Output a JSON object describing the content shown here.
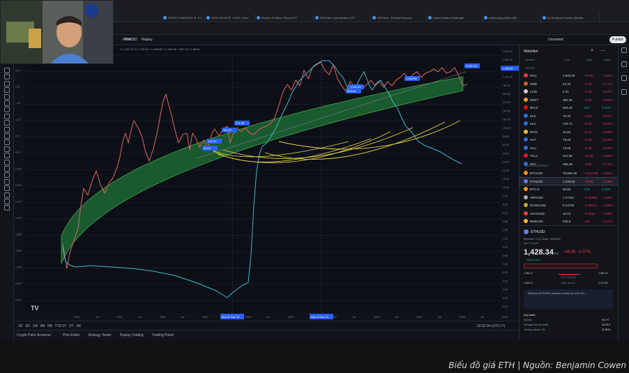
{
  "browser": {
    "tabs": [
      {
        "label": "ERFRT 0.00002208 ▼ -0.1"
      },
      {
        "label": "GGG 416.05 ▼ -1.06% | Unru"
      },
      {
        "label": "Modern Portfolio Theory | ET"
      },
      {
        "label": "ROI After Cycle Bottom | ET"
      },
      {
        "label": "EDPNow - Federal Reserve"
      },
      {
        "label": "United States Challenger"
      },
      {
        "label": "solidbull.jpg (640×480)"
      },
      {
        "label": "(1) Benjamin Cowen (@inthe"
      }
    ]
  },
  "toolbar": {
    "symbol": "ETHUSD",
    "alert": "Alert",
    "replay": "Replay",
    "layout": "Unnamed",
    "publish": "Publish",
    "ohlc": "O 1,427.37  H 1,790.43  L 1,408.96  C 1,428.83  −493.74 (−7.86%)"
  },
  "chart": {
    "price_labels": [
      {
        "text": "2,091.75",
        "color": "#2962ff"
      },
      {
        "text": "1,544.64",
        "color": "#2962ff"
      },
      {
        "text": "1,262.69",
        "color": "#2962ff"
      },
      {
        "text": "890.84",
        "color": "#2962ff"
      },
      {
        "text": "221.05",
        "color": "#2962ff"
      },
      {
        "text": "163.57",
        "color": "#2962ff"
      },
      {
        "text": "184.51",
        "color": "#2962ff"
      },
      {
        "text": "81.09",
        "color": "#2962ff"
      }
    ],
    "y_axis_right": [
      "3,000.00",
      "2,600.00",
      "1,428.83",
      "1,100.00",
      "780.00",
      "540.00",
      "376.00",
      "260.00",
      "180.00",
      "130.00",
      "90.00",
      "64.00",
      "44.00",
      "31.00",
      "22.00",
      "15.00",
      "11.00",
      "7.60",
      "5.30",
      "3.70",
      "2.60",
      "1.80",
      "1.25",
      "0.87",
      "0.60",
      "0.42",
      "0.29",
      "0.20",
      "0.14",
      "0.10",
      "0.07"
    ],
    "y_axis_left": [
      "4.0T",
      "3.0T",
      "2.0T",
      "1.4T",
      "1.0T",
      "0.7T",
      "0.5T",
      "0.35T",
      "0.25T",
      "0.17T",
      "0.12T",
      "0.08T",
      "0.06T",
      "0.04T",
      "0.03T",
      "0.02T"
    ],
    "x_axis": [
      "2016",
      "Jul",
      "2017",
      "Jul",
      "2018",
      "Jul",
      "2019",
      "Jul",
      "2020",
      "Jul",
      "2021",
      "Jul",
      "2022",
      "Jul",
      "2023",
      "Jul",
      "2024",
      "Jul",
      "2025",
      "Jul",
      "2026"
    ],
    "x_markers": [
      "Mon 02 Sep '19",
      "Mon 15 Nov '21"
    ],
    "colors": {
      "band": "#1f7a3a",
      "band_edge": "#5cbf5c",
      "candle_up": "#26a69a",
      "candle_down": "#ef5350",
      "dominance": "#3fb8c9",
      "arc": "#e8d44d"
    }
  },
  "bottom_strip": {
    "ranges": [
      "1D",
      "5D",
      "1M",
      "3M",
      "6M",
      "YTD",
      "1Y",
      "5Y",
      "All"
    ],
    "clock": "02:52:34 (UTC+7)"
  },
  "bottom_tabs": [
    "Crypto Pairs Screener",
    "Pine Editor",
    "Strategy Tester",
    "Replay Trading",
    "Trading Panel"
  ],
  "watchlist": {
    "title": "Watchlist",
    "headers": {
      "symbol": "Symbol",
      "last": "Last",
      "chg": "Chg",
      "pct": "Chg%"
    },
    "section_stocks": "STOCKS",
    "section_crypto": "CRYPTOCURRENCY",
    "rows": [
      {
        "sym": "ES1!",
        "last": "4,940.25",
        "chg": "−75.50",
        "pct": "−1.51%",
        "dir": "neg",
        "color": "#f23645"
      },
      {
        "sym": "GME",
        "last": "23.30",
        "chg": "−0.43",
        "pct": "−1.77%",
        "dir": "neg",
        "color": "#e05a2b"
      },
      {
        "sym": "LCID",
        "last": "2.31",
        "chg": "−0.15",
        "pct": "−0.37%",
        "dir": "neg",
        "color": "#d0d0d0"
      },
      {
        "sym": "MSFT",
        "last": "384.55",
        "chg": "−3.58",
        "pct": "−0.92%",
        "dir": "neg",
        "color": "#f4a41a"
      },
      {
        "sym": "NFLX",
        "last": "815.40",
        "chg": "2.67",
        "pct": "0.33%",
        "dir": "pos",
        "color": "#e50914"
      },
      {
        "sym": "XLE",
        "last": "75.40",
        "chg": "−1.61",
        "pct": "−2.11%",
        "dir": "neg",
        "color": "#2d6cdf"
      },
      {
        "sym": "XLK",
        "last": "176.72",
        "chg": "−5.73",
        "pct": "−3.23%",
        "dir": "neg",
        "color": "#2d6cdf"
      },
      {
        "sym": "RIVN",
        "last": "10.82",
        "chg": "−0.41",
        "pct": "−3.69%",
        "dir": "neg",
        "color": "#f0c23a"
      },
      {
        "sym": "XLP",
        "last": "79.25",
        "chg": "−0.15",
        "pct": "−0.19%",
        "dir": "neg",
        "color": "#2d6cdf"
      },
      {
        "sym": "XLU",
        "last": "73.09",
        "chg": "−0.29",
        "pct": "−0.40%",
        "dir": "neg",
        "color": "#2d6cdf"
      },
      {
        "sym": "TSLA",
        "last": "221.86",
        "chg": "−11.43",
        "pct": "−4.90%",
        "dir": "neg",
        "color": "#e31937"
      },
      {
        "sym": "SPY",
        "last": "496.48",
        "chg": "−8.62",
        "pct": "−1.71%",
        "dir": "neg",
        "color": "#2d6cdf"
      }
    ],
    "crypto_rows": [
      {
        "sym": "BTCUSD",
        "last": "76,865.35",
        "chg": "−3,012.95",
        "pct": "−3.92%",
        "dir": "neg",
        "color": "#f7931a"
      },
      {
        "sym": "ETHUSD",
        "last": "1,428.83",
        "chg": "−49.95",
        "pct": "−3.38%",
        "dir": "neg",
        "color": "#627eea"
      },
      {
        "sym": "BTC.D",
        "last": "62.65",
        "chg": "0.19",
        "pct": "0.33%",
        "dir": "pos",
        "color": "#f7931a"
      },
      {
        "sym": "XRPUSD",
        "last": "1.77110",
        "chg": "−0.02180",
        "pct": "−1.22%",
        "dir": "neg",
        "color": "#aaaaaa"
      },
      {
        "sym": "DOGEUSD",
        "last": "0.14706",
        "chg": "−0.00271",
        "pct": "−1.80%",
        "dir": "neg",
        "color": "#c2a633"
      },
      {
        "sym": "AVAXUSD",
        "last": "16.12",
        "chg": "−0.3310",
        "pct": "−1.98%",
        "dir": "neg",
        "color": "#e84142"
      },
      {
        "sym": "BNBUSD",
        "last": "546.5",
        "chg": "−6.9",
        "pct": "−1.17%",
        "dir": "neg",
        "color": "#f3ba2f"
      }
    ],
    "detail": {
      "symbol": "ETHUSD",
      "name": "Ethereum / U.S. Dollar",
      "exchange": "KRAKEN",
      "type": "Spot • Crypto",
      "price": "1,428.34",
      "currency": "USD",
      "change": "−43.95",
      "change_pct": "−2.97%",
      "market_status": "Market open",
      "day_low": "1,384.17",
      "day_high": "1,480.22",
      "day_range_label": "DAY'S RANGE",
      "week_low": "1,384.17",
      "week_high": "4,107.80",
      "week_range_label": "52WK RANGE",
      "news": "Ethereum (ETHUSD) reached a yearly low of $1,411, ...",
      "key_stats_title": "Key stats",
      "stats": [
        {
          "label": "Volume",
          "value": "5.17 K"
        },
        {
          "label": "Average Volume (30D)",
          "value": "16.78 K"
        },
        {
          "label": "Trading volume 24h",
          "value": "11.53 B"
        }
      ]
    }
  },
  "caption": "Biểu đồ giá ETH | Nguồn: Benjamin Cowen"
}
